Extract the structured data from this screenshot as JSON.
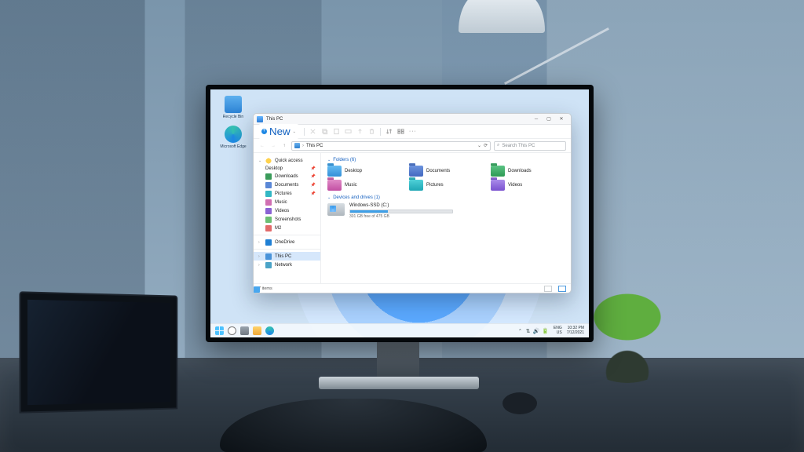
{
  "desktop": {
    "icons": [
      {
        "label": "Recycle Bin"
      },
      {
        "label": "Microsoft Edge"
      }
    ]
  },
  "taskbar": {
    "lang_top": "ENG",
    "lang_bot": "US",
    "time": "10:32 PM",
    "date": "7/12/2021",
    "chevron": "^"
  },
  "explorer": {
    "title": "This PC",
    "new_label": "New",
    "ellipsis": "···",
    "address": {
      "root": "This PC",
      "search_placeholder": "Search This PC"
    },
    "sidebar": {
      "quick": "Quick access",
      "items": [
        {
          "label": "Desktop",
          "pin": true
        },
        {
          "label": "Downloads",
          "pin": true
        },
        {
          "label": "Documents",
          "pin": true
        },
        {
          "label": "Pictures",
          "pin": true
        },
        {
          "label": "Music"
        },
        {
          "label": "Videos"
        },
        {
          "label": "Screenshots"
        },
        {
          "label": "M2"
        }
      ],
      "onedrive": "OneDrive",
      "thispc": "This PC",
      "network": "Network"
    },
    "sections": {
      "folders_hdr": "Folders (6)",
      "drives_hdr": "Devices and drives (1)"
    },
    "folders": [
      {
        "label": "Desktop",
        "cls": "desk"
      },
      {
        "label": "Documents",
        "cls": "docu"
      },
      {
        "label": "Downloads",
        "cls": "dl"
      },
      {
        "label": "Music",
        "cls": "mus"
      },
      {
        "label": "Pictures",
        "cls": "pic"
      },
      {
        "label": "Videos",
        "cls": "vid"
      }
    ],
    "drive": {
      "name": "Windows-SSD (C:)",
      "free": "301 GB free of 475 GB",
      "fill_pct": 37
    },
    "status": {
      "count": "7 items"
    }
  }
}
